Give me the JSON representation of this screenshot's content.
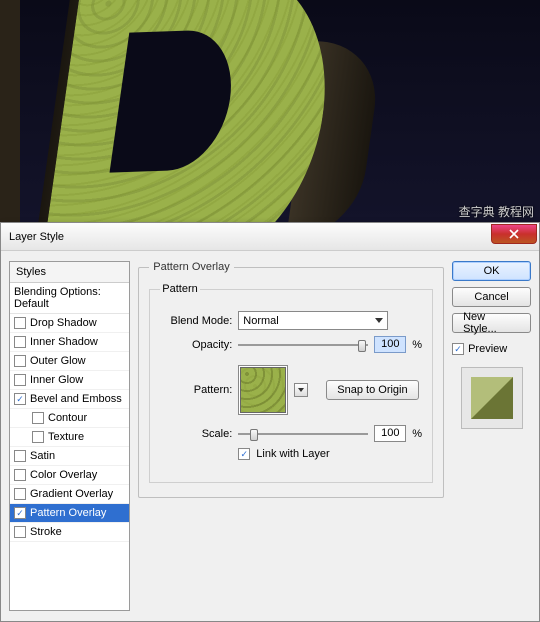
{
  "canvas": {
    "watermark": "查字典 教程网"
  },
  "dialog": {
    "title": "Layer Style",
    "styles_header": "Styles",
    "blending_options": "Blending Options: Default",
    "items": [
      {
        "label": "Drop Shadow",
        "checked": false,
        "indent": false
      },
      {
        "label": "Inner Shadow",
        "checked": false,
        "indent": false
      },
      {
        "label": "Outer Glow",
        "checked": false,
        "indent": false
      },
      {
        "label": "Inner Glow",
        "checked": false,
        "indent": false
      },
      {
        "label": "Bevel and Emboss",
        "checked": true,
        "indent": false
      },
      {
        "label": "Contour",
        "checked": false,
        "indent": true
      },
      {
        "label": "Texture",
        "checked": false,
        "indent": true
      },
      {
        "label": "Satin",
        "checked": false,
        "indent": false
      },
      {
        "label": "Color Overlay",
        "checked": false,
        "indent": false
      },
      {
        "label": "Gradient Overlay",
        "checked": false,
        "indent": false
      },
      {
        "label": "Pattern Overlay",
        "checked": true,
        "indent": false,
        "selected": true
      },
      {
        "label": "Stroke",
        "checked": false,
        "indent": false
      }
    ],
    "group_title": "Pattern Overlay",
    "inner_title": "Pattern",
    "blend_label": "Blend Mode:",
    "blend_value": "Normal",
    "opacity_label": "Opacity:",
    "opacity_value": "100",
    "pct": "%",
    "pattern_label": "Pattern:",
    "snap_label": "Snap to Origin",
    "scale_label": "Scale:",
    "scale_value": "100",
    "link_label": "Link with Layer",
    "link_checked": true,
    "buttons": {
      "ok": "OK",
      "cancel": "Cancel",
      "new_style": "New Style...",
      "preview": "Preview",
      "preview_checked": true
    }
  }
}
